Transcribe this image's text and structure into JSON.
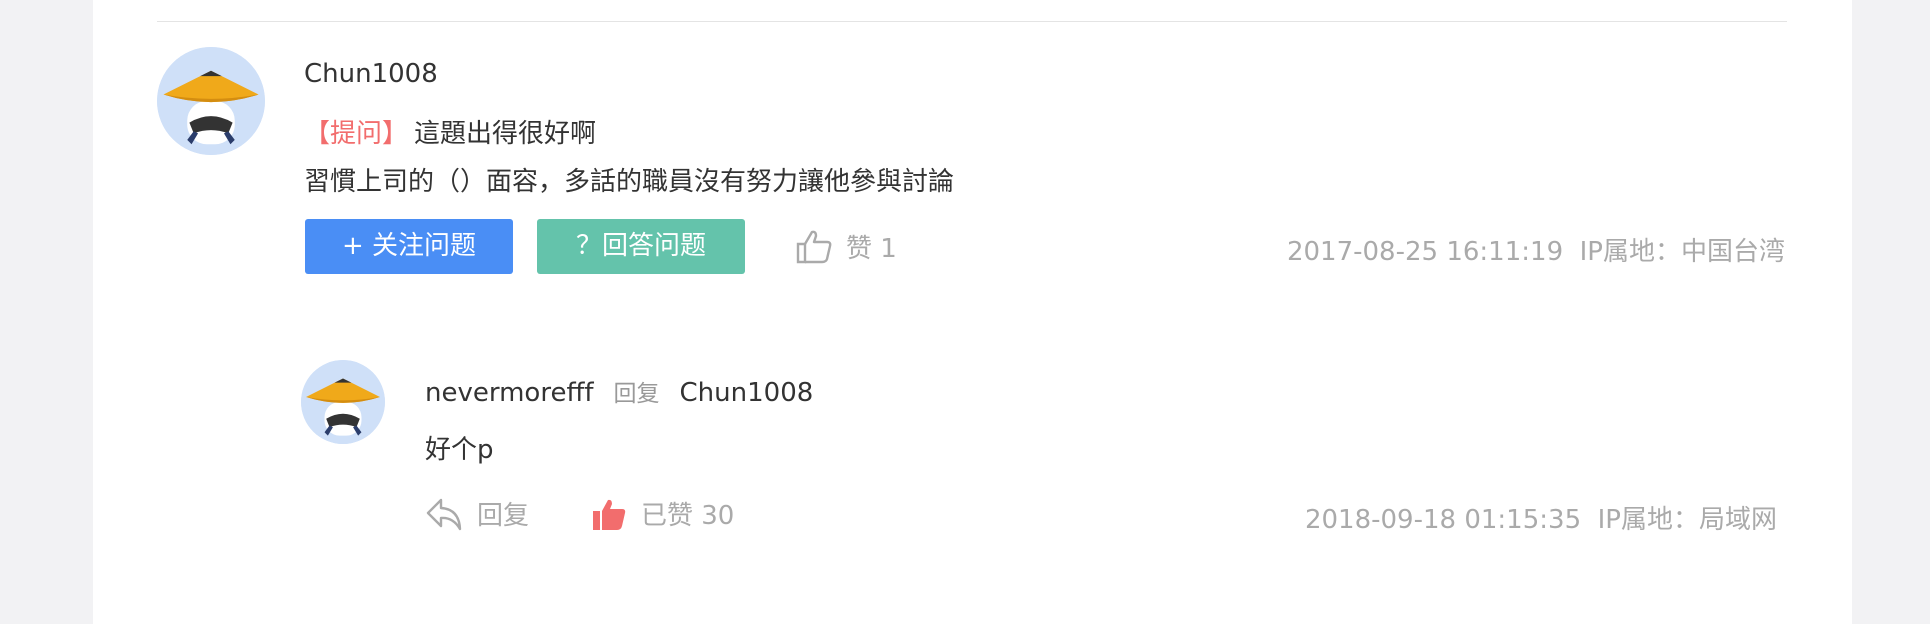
{
  "question": {
    "user": "Chun1008",
    "tag": "【提问】",
    "title": "這題出得很好啊",
    "text": "習慣上司的（）面容，多話的職員沒有努力讓他參與討論",
    "follow_button": "+ 关注问题",
    "answer_button": "？回答问题",
    "like_label": "赞 1",
    "timestamp": "2017-08-25 16:11:19",
    "ip_location": "IP属地：中国台湾"
  },
  "reply": {
    "user": "nevermorefff",
    "reply_word": "回复",
    "target_user": "Chun1008",
    "text": "好个p",
    "reply_label": "回复",
    "liked_label": "已赞 30",
    "timestamp": "2018-09-18 01:15:35",
    "ip_location": "IP属地：局域网"
  },
  "colors": {
    "tag": "#f26d6d",
    "follow_button": "#4a8ef5",
    "answer_button": "#64c3ab",
    "liked_thumb": "#f26d6d",
    "muted_text": "#aaaaaa"
  },
  "icons": {
    "avatar": "straw-hat-avatar-icon",
    "like": "thumbs-up-outline-icon",
    "liked": "thumbs-up-filled-icon",
    "reply": "reply-arrow-icon"
  }
}
